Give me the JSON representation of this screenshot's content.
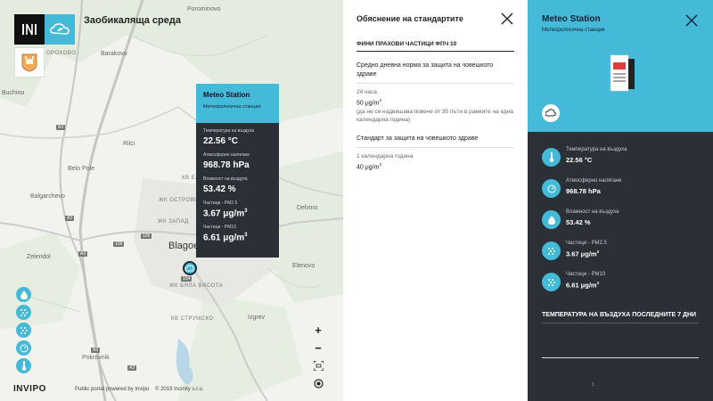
{
  "header": {
    "title": "Заобикаляща среда",
    "brand_icon": "cloud-leaf-icon",
    "crest_icon": "crest-icon"
  },
  "map": {
    "labels": {
      "porominovo": "Porominovo",
      "barakovo": "Barakovo",
      "buchino": "Buchino",
      "rilci": "Rilci",
      "belo_pole": "Belo Pole",
      "balgarchevo": "Balgarchevo",
      "delvino": "Delvino",
      "blagoevgrad": "Blagoev",
      "zelendol": "Zelendol",
      "elenovo": "Elenovo",
      "izgrev": "Izgrev",
      "pokrovnik": "Pokrovnik",
      "jk_zapad": "ЖК ЗАПАД",
      "jk_bqla_vista": "ЖК БЯЛА ВИСОТА",
      "kv_strumsko": "КВ СТРУМСКО",
      "jk_ostrovo": "ЖК ОСТРОВО",
      "kv_el": "КВ ЕЛ",
      "orohovo": "ОРОХОВО"
    },
    "roads": [
      "A3",
      "A3",
      "A3",
      "A3",
      "A3",
      "106",
      "106",
      "104"
    ],
    "layer_buttons": [
      "drop-icon",
      "dots-icon",
      "dots-icon",
      "gauge-icon",
      "thermometer-icon"
    ],
    "zoom": {
      "plus": "+",
      "minus": "−"
    },
    "footer": {
      "logo": "INVIPO",
      "powered": "Public portal powered by Invipo",
      "copyright": "© 2019 Incinity s.r.o."
    }
  },
  "popup": {
    "title": "Meteo Station",
    "subtitle": "Метеорологична станция",
    "metrics": [
      {
        "label": "Температура на въздуха",
        "value": "22.56 °C"
      },
      {
        "label": "Атмосферно налягане",
        "value": "968.78 hPa"
      },
      {
        "label": "Влажност на въздуха",
        "value": "53.42 %"
      },
      {
        "label": "Частици - PM2.5",
        "value": "3.67 μg/m",
        "sup": "3"
      },
      {
        "label": "Частици - PM10",
        "value": "6.61 μg/m",
        "sup": "3"
      }
    ]
  },
  "standards": {
    "title": "Обяснение на стандартите",
    "section": "ФИНИ ПРАХОВИ ЧАСТИЦИ ФПЧ 10",
    "blocks": [
      {
        "heading": "Средно дневна норма за защита на човешкото здраве",
        "period": "24 часа",
        "value": "50 μg/m",
        "sup": "3",
        "note": "(да не се надвишава повече от 35 пъти в рамките на една календарна година)"
      },
      {
        "heading": "Стандарт за защита на човешкото здраве",
        "period": "1 календарна година",
        "value": "40 μg/m",
        "sup": "3"
      }
    ]
  },
  "side": {
    "title": "Meteo Station",
    "subtitle": "Метеорологична станция",
    "rows": [
      {
        "icon": "thermometer-icon",
        "label": "Температура на въздуха",
        "value": "22.56 °C"
      },
      {
        "icon": "gauge-icon",
        "label": "Атмосферно налягане",
        "value": "968.78 hPa"
      },
      {
        "icon": "drop-icon",
        "label": "Влажност на въздуха",
        "value": "53.42 %"
      },
      {
        "icon": "dots-icon",
        "label": "Частици - PM2.5",
        "value": "3.67 μg/m",
        "sup": "3"
      },
      {
        "icon": "dots-icon",
        "label": "Частици - PM10",
        "value": "6.61 μg/m",
        "sup": "3"
      }
    ],
    "chart_title": "ТЕМПЕРАТУРА НА ВЪЗДУХА ПОСЛЕДНИТЕ 7 ДНИ",
    "chart_tick": "1"
  },
  "colors": {
    "accent": "#45b9d8",
    "dark": "#2a3036"
  }
}
